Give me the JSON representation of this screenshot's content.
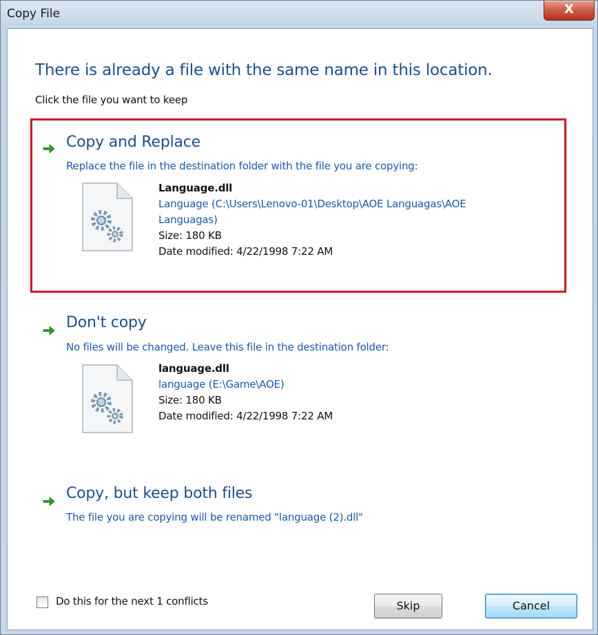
{
  "window": {
    "title": "Copy File",
    "close_label": "X"
  },
  "header": {
    "heading": "There is already a file with the same name in this location.",
    "subheading": "Click the file you want to keep"
  },
  "options": [
    {
      "title": "Copy and Replace",
      "description": "Replace the file in the destination folder with the file you are copying:",
      "highlighted": true,
      "highlight_color": "#c51f26",
      "file": {
        "name": "Language.dll",
        "path": "Language (C:\\Users\\Lenovo-01\\Desktop\\AOE Languagas\\AOE Languagas)",
        "size": "Size: 180 KB",
        "modified": "Date modified: 4/22/1998 7:22 AM",
        "icon": "dll-gear-file-icon"
      }
    },
    {
      "title": "Don't copy",
      "description": "No files will be changed. Leave this file in the destination folder:",
      "highlighted": false,
      "file": {
        "name": "language.dll",
        "path": "language (E:\\Game\\AOE)",
        "size": "Size: 180 KB",
        "modified": "Date modified: 4/22/1998 7:22 AM",
        "icon": "dll-gear-file-icon"
      }
    },
    {
      "title": "Copy, but keep both files",
      "description": "The file you are copying will be renamed \"language (2).dll\"",
      "highlighted": false
    }
  ],
  "footer": {
    "checkbox_label": "Do this for the next 1 conflicts",
    "checkbox_checked": false,
    "skip_label": "Skip",
    "cancel_label": "Cancel"
  },
  "colors": {
    "heading": "#1d4f8a",
    "link": "#1a5aa6",
    "arrow": "#2f9e2f",
    "close_button": "#c8442e"
  }
}
